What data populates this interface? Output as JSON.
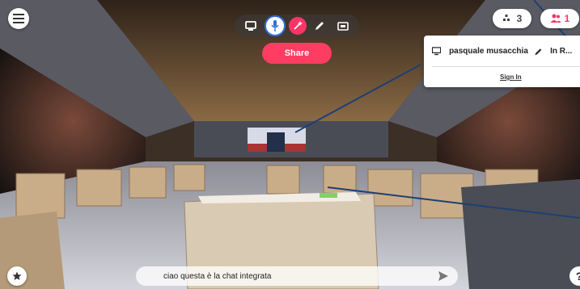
{
  "toolbar": {
    "icons": [
      "screen-share-icon",
      "microphone-icon",
      "magic-wand-icon",
      "pen-icon",
      "media-icon"
    ]
  },
  "share_label": "Share",
  "objects_count": "3",
  "people_count": "1",
  "people_panel": {
    "user_name": "pasquale musacchia",
    "status": "In R...",
    "sign_in": "Sign In"
  },
  "chat": {
    "message": "ciao questa è la chat integrata"
  },
  "help_label": "?",
  "colors": {
    "accent": "#ff3d63",
    "mic_ring": "#2f6fd6",
    "annotation_line": "#1e3f73"
  }
}
